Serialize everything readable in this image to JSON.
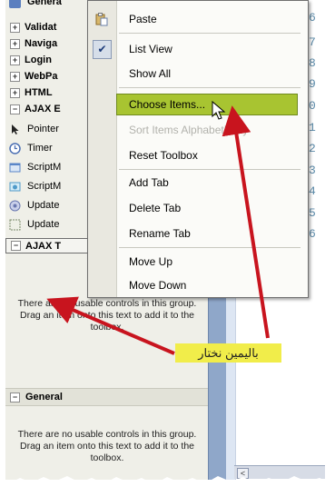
{
  "toolbox": {
    "partial_top": "Genera",
    "groups": [
      {
        "label": "Validat",
        "symbol": "+"
      },
      {
        "label": "Naviga",
        "symbol": "+"
      },
      {
        "label": "Login",
        "symbol": "+"
      },
      {
        "label": "WebPa",
        "symbol": "+"
      },
      {
        "label": "HTML",
        "symbol": "+"
      },
      {
        "label": "AJAX E",
        "symbol": "−"
      }
    ],
    "items": [
      {
        "label": "Pointer",
        "icon": "pointer-icon",
        "color": "#3a3a3a"
      },
      {
        "label": "Timer",
        "icon": "timer-icon",
        "color": "#4b6fb3"
      },
      {
        "label": "ScriptM",
        "icon": "script-manager-icon",
        "color": "#5a86c8"
      },
      {
        "label": "ScriptM",
        "icon": "script-manager-proxy-icon",
        "color": "#4f9ac9"
      },
      {
        "label": "Update",
        "icon": "update-progress-icon",
        "color": "#6a78b0"
      },
      {
        "label": "Update",
        "icon": "update-panel-icon",
        "color": "#7a8a6a"
      }
    ],
    "ajax_tab": {
      "label": "AJAX T",
      "symbol": "−"
    },
    "ajax_message": "There are no usable controls in this group. Drag an item onto this text to add it to the toolbox.",
    "general": {
      "label": "General",
      "symbol": "−"
    },
    "general_message": "There are no usable controls in this group. Drag an item onto this text to add it to the toolbox."
  },
  "context_menu": {
    "items": [
      {
        "label": "Paste",
        "icon": "paste-icon"
      },
      {
        "label": "List View",
        "checked": true
      },
      {
        "label": "Show All"
      },
      {
        "label": "Choose Items...",
        "highlighted": true
      },
      {
        "label": "Sort Items Alphabetically",
        "disabled": true
      },
      {
        "label": "Reset Toolbox"
      },
      {
        "label": "Add Tab"
      },
      {
        "label": "Delete Tab"
      },
      {
        "label": "Rename Tab"
      },
      {
        "label": "Move Up"
      },
      {
        "label": "Move Down"
      }
    ]
  },
  "editor": {
    "line_numbers": [
      "6",
      "7",
      "8",
      "9",
      "0",
      "1",
      "2",
      "3",
      "4",
      "5",
      "6"
    ],
    "scroll_left_symbol": "<"
  },
  "annotation": {
    "caption": "باليمين نختار",
    "arrow_color": "#c8141e",
    "caption_bg": "#f1ed4a",
    "highlight_color": "#a8c431"
  }
}
